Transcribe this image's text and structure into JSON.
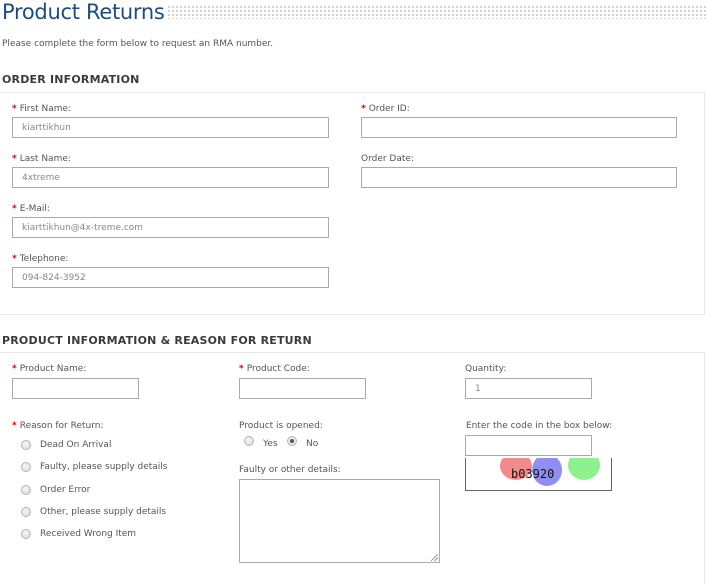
{
  "page": {
    "title": "Product Returns",
    "intro": "Please complete the form below to request an RMA number."
  },
  "order_section": {
    "heading": "ORDER INFORMATION",
    "first_name": {
      "label": "First Name:",
      "value": "kiarttikhun"
    },
    "last_name": {
      "label": "Last Name:",
      "value": "4xtreme"
    },
    "email": {
      "label": "E-Mail:",
      "value": "kiarttikhun@4x-treme.com"
    },
    "telephone": {
      "label": "Telephone:",
      "value": "094-824-3952"
    },
    "order_id": {
      "label": "Order ID:",
      "value": ""
    },
    "order_date": {
      "label": "Order Date:",
      "value": ""
    }
  },
  "product_section": {
    "heading": "PRODUCT INFORMATION & REASON FOR RETURN",
    "product_name": {
      "label": "Product Name:",
      "value": ""
    },
    "product_code": {
      "label": "Product Code:",
      "value": ""
    },
    "quantity": {
      "label": "Quantity:",
      "value": "1"
    },
    "reason": {
      "label": "Reason for Return:",
      "options": [
        "Dead On Arrival",
        "Faulty, please supply details",
        "Order Error",
        "Other, please supply details",
        "Received Wrong Item"
      ]
    },
    "opened": {
      "label": "Product is opened:",
      "yes": "Yes",
      "no": "No",
      "selected": "No"
    },
    "details": {
      "label": "Faulty or other details:"
    },
    "captcha": {
      "label": "Enter the code in the box below:",
      "value": "",
      "code": "b03920"
    }
  },
  "colors": {
    "title": "#1f4d7a",
    "required": "#cc0000",
    "captcha_red": "#f28b8b",
    "captcha_blue": "#8f8ff0",
    "captcha_green": "#8ef08e"
  }
}
